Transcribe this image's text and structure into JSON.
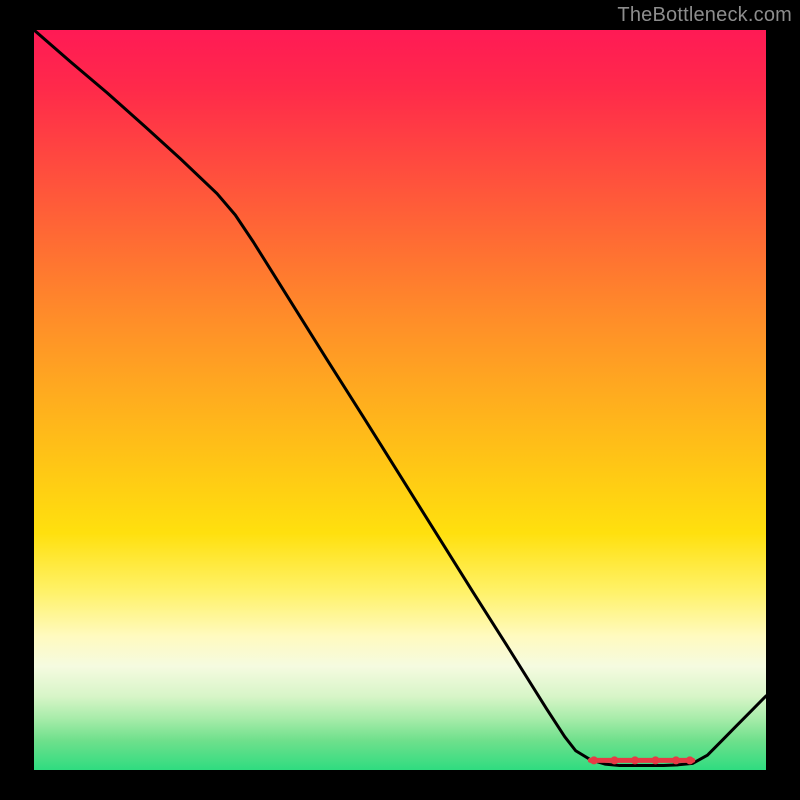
{
  "attribution": "TheBottleneck.com",
  "chart_data": {
    "type": "line",
    "title": "",
    "xlabel": "",
    "ylabel": "",
    "xlim": [
      0,
      1
    ],
    "ylim": [
      0,
      1
    ],
    "series": [
      {
        "name": "curve",
        "x": [
          0.0,
          0.05,
          0.1,
          0.15,
          0.2,
          0.25,
          0.275,
          0.3,
          0.35,
          0.4,
          0.45,
          0.5,
          0.55,
          0.6,
          0.65,
          0.7,
          0.725,
          0.74,
          0.76,
          0.78,
          0.8,
          0.82,
          0.84,
          0.86,
          0.88,
          0.9,
          0.92,
          0.94,
          0.96,
          0.98,
          1.0
        ],
        "y": [
          1.0,
          0.957,
          0.915,
          0.871,
          0.826,
          0.779,
          0.75,
          0.713,
          0.634,
          0.555,
          0.477,
          0.398,
          0.319,
          0.24,
          0.162,
          0.083,
          0.045,
          0.026,
          0.014,
          0.008,
          0.006,
          0.006,
          0.006,
          0.006,
          0.007,
          0.009,
          0.02,
          0.04,
          0.06,
          0.08,
          0.1
        ]
      }
    ],
    "flat_segment": {
      "x_start": 0.76,
      "x_end": 0.9,
      "y": 0.013,
      "markers_x": [
        0.765,
        0.793,
        0.821,
        0.849,
        0.877,
        0.896
      ],
      "marker_radius": 4,
      "color": "#e53b45"
    },
    "line_stroke_width": 3,
    "line_color": "#000000"
  }
}
